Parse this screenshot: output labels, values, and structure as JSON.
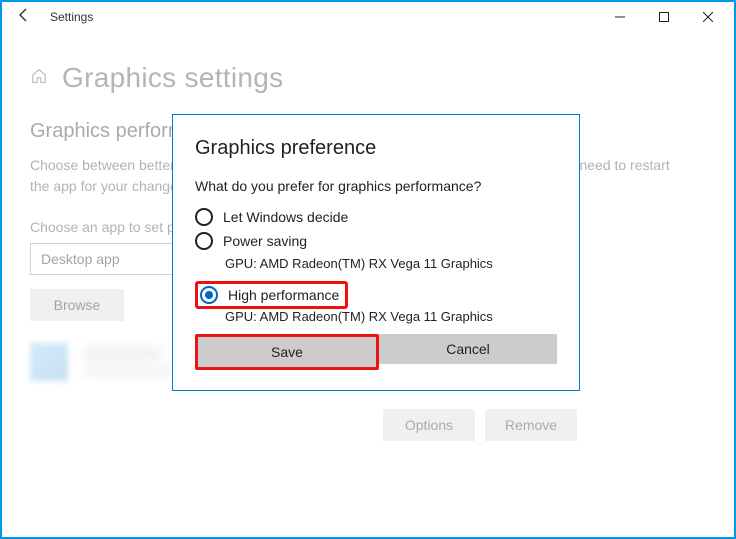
{
  "window": {
    "title": "Settings"
  },
  "page": {
    "heading": "Graphics settings",
    "subheading": "Graphics performance preference",
    "description": "Choose between better performance or longer battery life when using an app. You might need to restart the app for your changes to take effect.",
    "choose_label": "Choose an app to set preference",
    "select_value": "Desktop app",
    "browse": "Browse",
    "options": "Options",
    "remove": "Remove"
  },
  "modal": {
    "title": "Graphics preference",
    "question": "What do you prefer for graphics performance?",
    "opts": [
      {
        "label": "Let Windows decide",
        "sub": ""
      },
      {
        "label": "Power saving",
        "sub": "GPU: AMD Radeon(TM) RX Vega 11 Graphics"
      },
      {
        "label": "High performance",
        "sub": "GPU: AMD Radeon(TM) RX Vega 11 Graphics"
      }
    ],
    "save": "Save",
    "cancel": "Cancel"
  }
}
